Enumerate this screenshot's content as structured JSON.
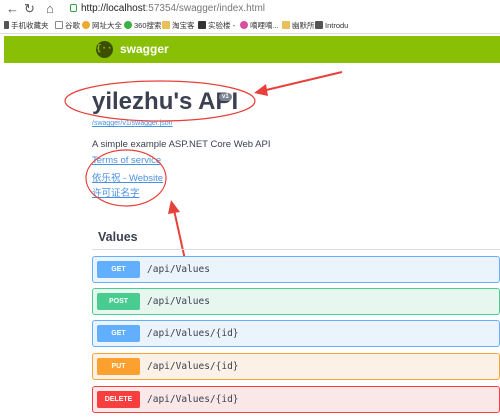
{
  "browser": {
    "back_icon": "back-arrow-icon",
    "reload_icon": "reload-icon",
    "home_icon": "home-icon",
    "url_host": "http://localhost",
    "url_rest": ":57354/swagger/index.html",
    "bookmarks": [
      {
        "label": "手机收藏夹",
        "icon": "phone-icon",
        "color": "#555555"
      },
      {
        "label": "谷歌",
        "icon": "page-icon",
        "color": "#888888"
      },
      {
        "label": "网址大全",
        "icon": "globe-icon",
        "color": "#f0a830"
      },
      {
        "label": "360搜索",
        "icon": "search-360-icon",
        "color": "#3cb043"
      },
      {
        "label": "淘宝客",
        "icon": "folder-icon",
        "color": "#e8c05a"
      },
      {
        "label": "实验楼 -",
        "icon": "flask-icon",
        "color": "#333333"
      },
      {
        "label": "嘀哩嘀...",
        "icon": "bili-icon",
        "color": "#d94fa0"
      },
      {
        "label": "幽默所",
        "icon": "folder-icon",
        "color": "#e8c05a"
      },
      {
        "label": "Introdu",
        "icon": "book-icon",
        "color": "#555555"
      }
    ]
  },
  "topbar": {
    "logo_glyph": "{···}",
    "logo_text": "swagger",
    "bg_color": "#89bf04"
  },
  "info": {
    "title": "yilezhu's API",
    "version": "v1",
    "spec_link": "/swagger/v1/swagger.json",
    "description": "A simple example ASP.NET Core Web API",
    "links": {
      "terms": "Terms of service",
      "website": "依乐祝 - Website",
      "license": "许可证名字"
    }
  },
  "tag": {
    "name": "Values"
  },
  "operations": [
    {
      "method": "GET",
      "path": "/api/Values",
      "color": "#61affe",
      "bg": "#ebf3fb"
    },
    {
      "method": "POST",
      "path": "/api/Values",
      "color": "#49cc90",
      "bg": "#e8f6f0"
    },
    {
      "method": "GET",
      "path": "/api/Values/{id}",
      "color": "#61affe",
      "bg": "#ebf3fb"
    },
    {
      "method": "PUT",
      "path": "/api/Values/{id}",
      "color": "#fca130",
      "bg": "#fbf1e6"
    },
    {
      "method": "DELETE",
      "path": "/api/Values/{id}",
      "color": "#f93e3e",
      "bg": "#fae7e7"
    }
  ],
  "annotations": {
    "color": "#e8403a"
  }
}
